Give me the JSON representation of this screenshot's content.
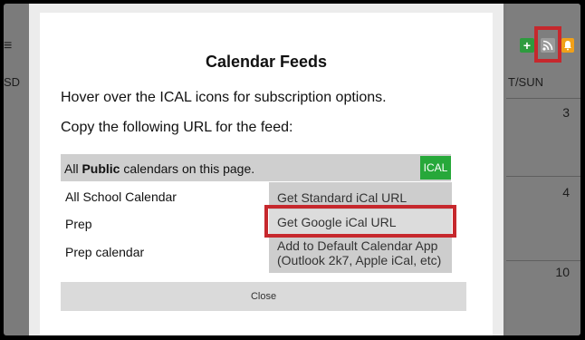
{
  "background": {
    "left_header_fragment": "SD",
    "day_header": "T/SUN",
    "days": [
      "3",
      "4",
      "10"
    ],
    "toolbar_icons": [
      "plus-icon",
      "rss-icon",
      "bell-icon"
    ]
  },
  "modal": {
    "title": "Calendar Feeds",
    "hover_instruction": "Hover over the ICAL icons for subscription options.",
    "copy_instruction": "Copy the following URL for the feed:",
    "feed_bar": {
      "prefix": "All ",
      "bold": "Public",
      "suffix": " calendars on this page.",
      "ical_label": "ICAL"
    },
    "calendars": [
      "All School Calendar",
      "Prep",
      "Prep calendar"
    ],
    "dropdown": {
      "items": [
        "Get Standard iCal URL",
        "Get Google iCal URL",
        "Add to Default Calendar App (Outlook 2k7, Apple iCal, etc)"
      ]
    },
    "close_label": "Close"
  },
  "colors": {
    "ical_green": "#27a83a",
    "highlight_red": "#c6282d",
    "rss_grey": "#9b9b9b",
    "bell_orange": "#f0a019"
  }
}
